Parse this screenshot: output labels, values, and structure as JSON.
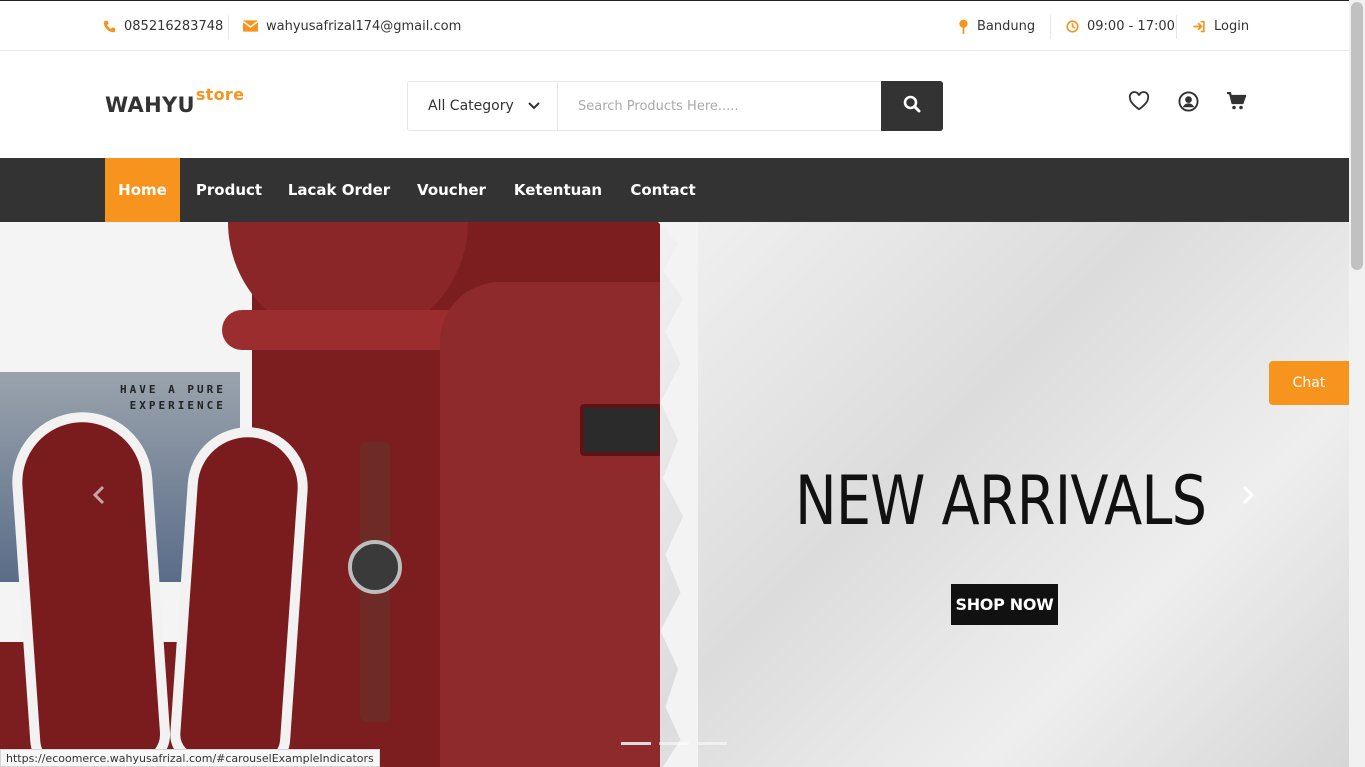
{
  "topbar": {
    "phone": "085216283748",
    "email": "wahyusafrizal174@gmail.com",
    "location": "Bandung",
    "hours": "09:00 - 17:00",
    "login": "Login"
  },
  "header": {
    "logo_main": "WAHYU",
    "logo_sup": "store",
    "category": "All Category",
    "search_placeholder": "Search Products Here....."
  },
  "nav": {
    "items": [
      "Home",
      "Product",
      "Lacak Order",
      "Voucher",
      "Ketentuan",
      "Contact"
    ],
    "active": "Home"
  },
  "hero": {
    "headline": "NEW ARRIVALS",
    "button": "SHOP NOW",
    "tshirt_text": "HAVE A PURE\nEXPERIENCE",
    "slide_count": 3,
    "active_slide": 1
  },
  "chat": {
    "label": "Chat"
  },
  "status": {
    "url": "https://ecoomerce.wahyusafrizal.com/#carouselExampleIndicators"
  },
  "colors": {
    "accent": "#f7941d",
    "dark": "#333333"
  }
}
